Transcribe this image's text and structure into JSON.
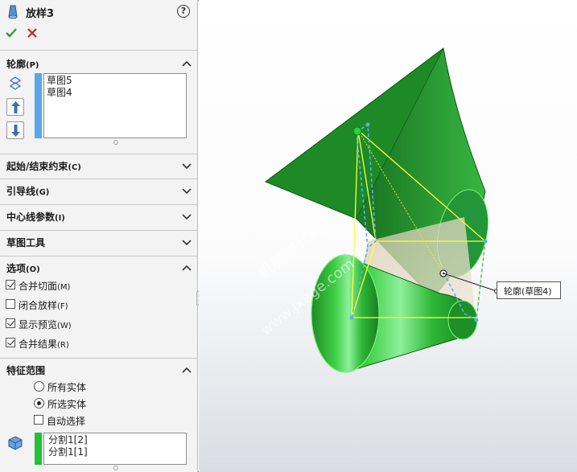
{
  "window": {
    "title": "放样3",
    "help_icon": "?"
  },
  "profile": {
    "label": "轮廓",
    "hotkey": "(P)",
    "items": [
      "草图5",
      "草图4"
    ],
    "bar_color": "#5aa7e8"
  },
  "sections": {
    "start_end": {
      "label": "起始/结束约束",
      "hotkey": "(C)"
    },
    "guides": {
      "label": "引导线",
      "hotkey": "(G)"
    },
    "centerline": {
      "label": "中心线参数",
      "hotkey": "(I)"
    },
    "sketch_tools": {
      "label": "草图工具"
    }
  },
  "options": {
    "label": "选项",
    "hotkey": "(O)",
    "items": [
      {
        "label": "合并切面",
        "hotkey": "(M)",
        "checked": true
      },
      {
        "label": "闭合放样",
        "hotkey": "(F)",
        "checked": false
      },
      {
        "label": "显示预览",
        "hotkey": "(W)",
        "checked": true
      },
      {
        "label": "合并结果",
        "hotkey": "(R)",
        "checked": true
      }
    ]
  },
  "feature_scope": {
    "label": "特征范围",
    "radios": [
      {
        "label": "所有实体",
        "selected": false
      },
      {
        "label": "所选实体",
        "selected": true
      }
    ],
    "auto_select": {
      "label": "自动选择",
      "checked": false
    },
    "bodies": [
      "分割1[2]",
      "分割1[1]"
    ],
    "bar_color": "#22c13a"
  },
  "viewport": {
    "callout": "轮廓(草图4)",
    "watermark_cn": "机械时代网",
    "watermark_url": "www.jxage.com",
    "model_color": "#1fae2e",
    "profile_line_color": "#ffff33"
  }
}
